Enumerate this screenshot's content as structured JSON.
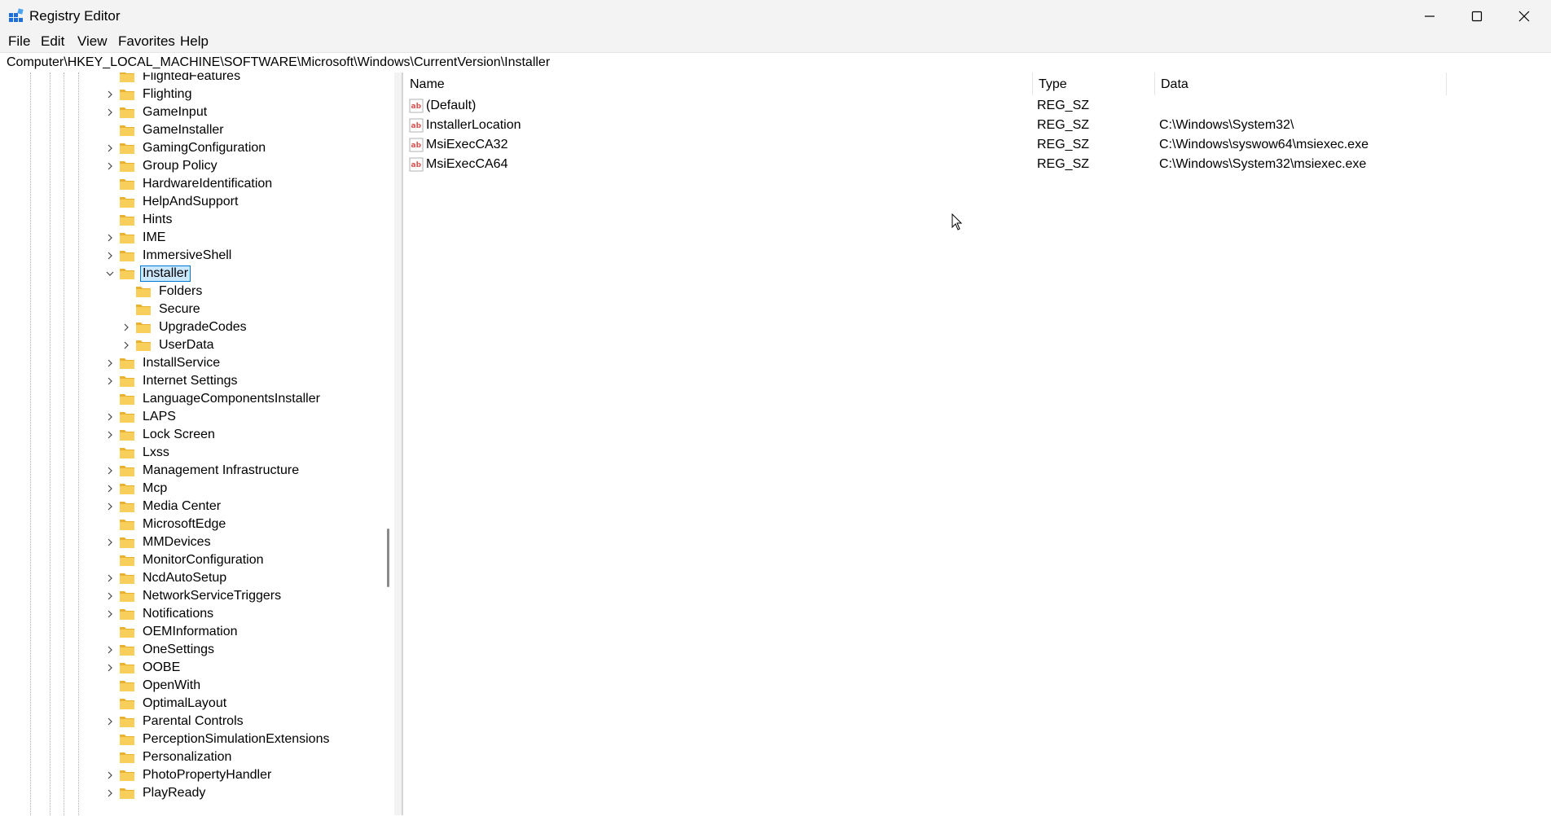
{
  "window": {
    "title": "Registry Editor"
  },
  "menu": [
    "File",
    "Edit",
    "View",
    "Favorites",
    "Help"
  ],
  "address": "Computer\\HKEY_LOCAL_MACHINE\\SOFTWARE\\Microsoft\\Windows\\CurrentVersion\\Installer",
  "tree": [
    {
      "label": "FlightedFeatures",
      "expandable": false,
      "level": 0
    },
    {
      "label": "Flighting",
      "expandable": true,
      "level": 0
    },
    {
      "label": "GameInput",
      "expandable": true,
      "level": 0
    },
    {
      "label": "GameInstaller",
      "expandable": false,
      "level": 0
    },
    {
      "label": "GamingConfiguration",
      "expandable": true,
      "level": 0
    },
    {
      "label": "Group Policy",
      "expandable": true,
      "level": 0
    },
    {
      "label": "HardwareIdentification",
      "expandable": false,
      "level": 0
    },
    {
      "label": "HelpAndSupport",
      "expandable": false,
      "level": 0
    },
    {
      "label": "Hints",
      "expandable": false,
      "level": 0
    },
    {
      "label": "IME",
      "expandable": true,
      "level": 0
    },
    {
      "label": "ImmersiveShell",
      "expandable": true,
      "level": 0
    },
    {
      "label": "Installer",
      "expandable": true,
      "expanded": true,
      "selected": true,
      "level": 0
    },
    {
      "label": "Folders",
      "expandable": false,
      "level": 1
    },
    {
      "label": "Secure",
      "expandable": false,
      "level": 1
    },
    {
      "label": "UpgradeCodes",
      "expandable": true,
      "level": 1
    },
    {
      "label": "UserData",
      "expandable": true,
      "level": 1
    },
    {
      "label": "InstallService",
      "expandable": true,
      "level": 0
    },
    {
      "label": "Internet Settings",
      "expandable": true,
      "level": 0
    },
    {
      "label": "LanguageComponentsInstaller",
      "expandable": false,
      "level": 0
    },
    {
      "label": "LAPS",
      "expandable": true,
      "level": 0
    },
    {
      "label": "Lock Screen",
      "expandable": true,
      "level": 0
    },
    {
      "label": "Lxss",
      "expandable": false,
      "level": 0
    },
    {
      "label": "Management Infrastructure",
      "expandable": true,
      "level": 0
    },
    {
      "label": "Mcp",
      "expandable": true,
      "level": 0
    },
    {
      "label": "Media Center",
      "expandable": true,
      "level": 0
    },
    {
      "label": "MicrosoftEdge",
      "expandable": false,
      "level": 0
    },
    {
      "label": "MMDevices",
      "expandable": true,
      "level": 0
    },
    {
      "label": "MonitorConfiguration",
      "expandable": false,
      "level": 0
    },
    {
      "label": "NcdAutoSetup",
      "expandable": true,
      "level": 0
    },
    {
      "label": "NetworkServiceTriggers",
      "expandable": true,
      "level": 0
    },
    {
      "label": "Notifications",
      "expandable": true,
      "level": 0
    },
    {
      "label": "OEMInformation",
      "expandable": false,
      "level": 0
    },
    {
      "label": "OneSettings",
      "expandable": true,
      "level": 0
    },
    {
      "label": "OOBE",
      "expandable": true,
      "level": 0
    },
    {
      "label": "OpenWith",
      "expandable": false,
      "level": 0
    },
    {
      "label": "OptimalLayout",
      "expandable": false,
      "level": 0
    },
    {
      "label": "Parental Controls",
      "expandable": true,
      "level": 0
    },
    {
      "label": "PerceptionSimulationExtensions",
      "expandable": false,
      "level": 0
    },
    {
      "label": "Personalization",
      "expandable": false,
      "level": 0
    },
    {
      "label": "PhotoPropertyHandler",
      "expandable": true,
      "level": 0
    },
    {
      "label": "PlayReady",
      "expandable": true,
      "level": 0
    }
  ],
  "list": {
    "columns": [
      "Name",
      "Type",
      "Data"
    ],
    "rows": [
      {
        "name": "(Default)",
        "type": "REG_SZ",
        "data": ""
      },
      {
        "name": "InstallerLocation",
        "type": "REG_SZ",
        "data": "C:\\Windows\\System32\\"
      },
      {
        "name": "MsiExecCA32",
        "type": "REG_SZ",
        "data": "C:\\Windows\\syswow64\\msiexec.exe"
      },
      {
        "name": "MsiExecCA64",
        "type": "REG_SZ",
        "data": "C:\\Windows\\System32\\msiexec.exe"
      }
    ]
  },
  "icons": {
    "app": "registry-icon",
    "folder": "folder-icon",
    "value": "string-value-icon"
  },
  "colors": {
    "folder": "#f5c542",
    "selection": "#cce8ff",
    "accent": "#0078d4",
    "value_icon": "#d9534f"
  }
}
